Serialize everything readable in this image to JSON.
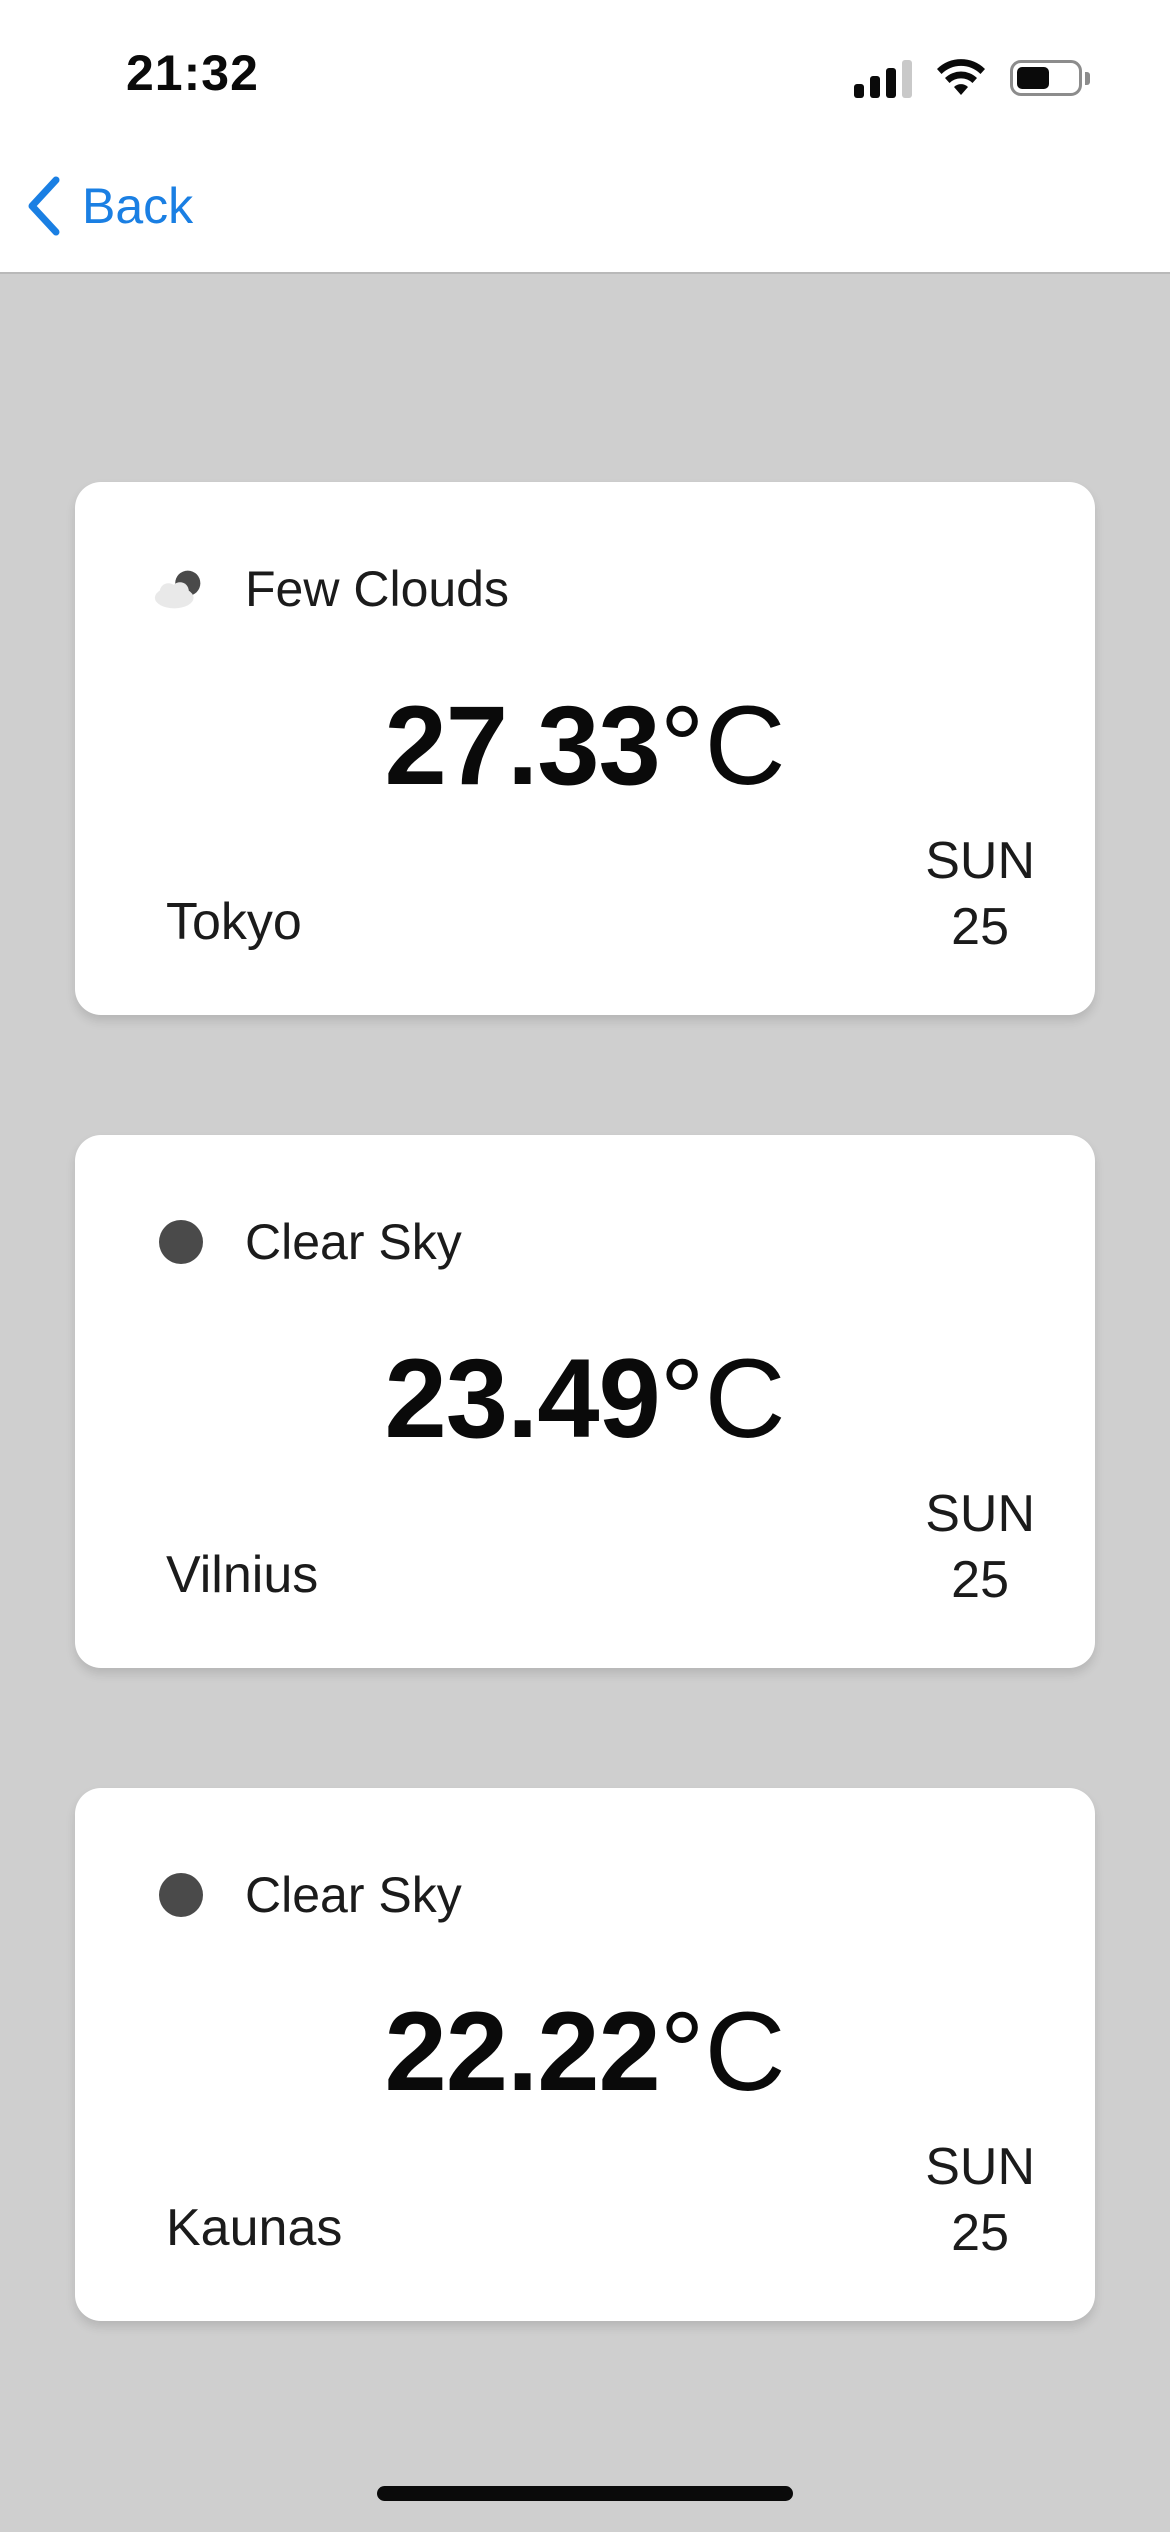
{
  "status_bar": {
    "time": "21:32",
    "signal_icon": "cellular-signal-icon",
    "wifi_icon": "wifi-icon",
    "battery_icon": "battery-icon",
    "battery_level": 0.55
  },
  "nav": {
    "back_label": "Back",
    "back_icon": "chevron-left-icon",
    "accent_color": "#1a7fe3"
  },
  "cards": [
    {
      "condition": "Few Clouds",
      "icon": "few-clouds-icon",
      "temperature": "27.33",
      "unit": "°C",
      "city": "Tokyo",
      "day": "SUN",
      "date": "25"
    },
    {
      "condition": "Clear Sky",
      "icon": "clear-sky-icon",
      "temperature": "23.49",
      "unit": "°C",
      "city": "Vilnius",
      "day": "SUN",
      "date": "25"
    },
    {
      "condition": "Clear Sky",
      "icon": "clear-sky-icon",
      "temperature": "22.22",
      "unit": "°C",
      "city": "Kaunas",
      "day": "SUN",
      "date": "25"
    }
  ]
}
